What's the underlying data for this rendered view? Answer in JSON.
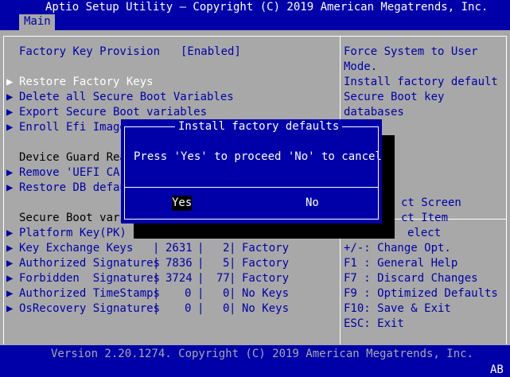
{
  "header": {
    "title": "Aptio Setup Utility – Copyright (C) 2019 American Megatrends, Inc.",
    "tab": "Main"
  },
  "menu": {
    "factory_key_label": "Factory Key Provision",
    "factory_key_value": "[Enabled]",
    "restore_factory": "Restore Factory Keys",
    "delete_all": "Delete all Secure Boot Variables",
    "export_secure": "Export Secure Boot variables",
    "enroll_efi": "Enroll Efi Image",
    "device_guard": "Device Guard Rea",
    "remove_uefi": "Remove 'UEFI CA'",
    "restore_db": "Restore DB defau",
    "secure_boot_vars": "Secure Boot vari",
    "platform_key": "Platform Key(PK)",
    "rows": [
      {
        "name": "Key Exchange Keys ",
        "size": "2631",
        "count": "2",
        "source": "Factory"
      },
      {
        "name": "Authorized Signatures",
        "size": "7836",
        "count": "5",
        "source": "Factory"
      },
      {
        "name": "Forbidden  Signatures",
        "size": "3724",
        "count": "77",
        "source": "Factory"
      },
      {
        "name": "Authorized TimeStamps",
        "size": "0",
        "count": "0",
        "source": "No Keys"
      },
      {
        "name": "OsRecovery Signatures",
        "size": "0",
        "count": "0",
        "source": "No Keys"
      }
    ]
  },
  "help": {
    "lines": [
      "Force System to User",
      "Mode.",
      "Install factory default",
      "Secure Boot key",
      "databases"
    ],
    "keys": [
      "ct Screen",
      "ct Item",
      "elect",
      "+/-: Change Opt.",
      "F1 : General Help",
      "F7 : Discard Changes",
      "F9 : Optimized Defaults",
      "F10: Save & Exit",
      "ESC: Exit"
    ]
  },
  "dialog": {
    "title": "Install factory defaults",
    "message": "Press 'Yes' to proceed 'No' to cancel",
    "yes": "Yes",
    "no": "No"
  },
  "footer": {
    "version": "Version 2.20.1274. Copyright (C) 2019 American Megatrends, Inc.",
    "corner": "AB"
  },
  "colors": {
    "bios_blue": "#0000a8",
    "bios_gray": "#a8a8a8"
  }
}
